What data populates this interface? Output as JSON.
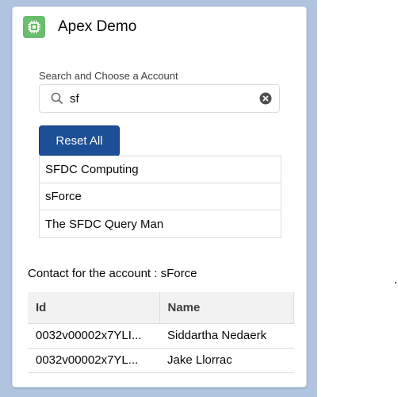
{
  "app": {
    "title": "Apex Demo"
  },
  "search": {
    "label": "Search and Choose a Account",
    "value": "sf"
  },
  "reset_button": {
    "label": "Reset All"
  },
  "accounts": [
    {
      "name": "SFDC Computing"
    },
    {
      "name": "sForce"
    },
    {
      "name": "The SFDC Query Man"
    }
  ],
  "contacts": {
    "heading": "Contact for the account : sForce",
    "columns": [
      "Id",
      "Name"
    ],
    "rows": [
      {
        "id": "0032v00002x7YLI...",
        "name": "Siddartha Nedaerk"
      },
      {
        "id": "0032v00002x7YL...",
        "name": "Jake Llorrac"
      }
    ]
  },
  "colors": {
    "page_background": "#b0c4df",
    "brand_button": "#1c4f95",
    "app_icon": "#6bbd6e"
  },
  "icons": {
    "app": "chip-icon",
    "search": "search-icon",
    "clear": "clear-icon"
  }
}
